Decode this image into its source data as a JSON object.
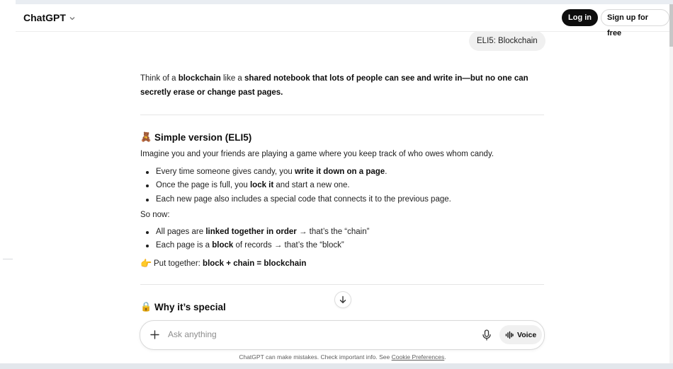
{
  "header": {
    "brand": "ChatGPT",
    "login_label": "Log in",
    "signup_label": "Sign up for free"
  },
  "user_message": "ELI5: Blockchain",
  "intro": {
    "t1": "Think of a ",
    "b1": "blockchain",
    "t2": " like a ",
    "b2": "shared notebook that lots of people can see and write in—but no one can secretly erase or change past pages."
  },
  "section1": {
    "emoji": "🧸",
    "title": "Simple version (ELI5)",
    "lead": "Imagine you and your friends are playing a game where you keep track of who owes whom candy.",
    "bullets": [
      {
        "t1": "Every time someone gives candy, you ",
        "b": "write it down on a page",
        "t2": "."
      },
      {
        "t1": "Once the page is full, you ",
        "b": "lock it",
        "t2": " and start a new one."
      },
      {
        "t1": "Each new page also includes a special code that connects it to the previous page.",
        "b": "",
        "t2": ""
      }
    ],
    "so_now": "So now:",
    "bullets2": [
      {
        "t1": "All pages are ",
        "b": "linked together in order",
        "t2": " → that’s the “chain”"
      },
      {
        "t1": "Each page is a ",
        "b": "block",
        "t2": " of records → that’s the “block”"
      }
    ],
    "together_emoji": "👉",
    "together_t": "Put together: ",
    "together_b": "block + chain = blockchain"
  },
  "section2": {
    "emoji": "🔒",
    "title": "Why it’s special"
  },
  "composer": {
    "placeholder": "Ask anything",
    "voice_label": "Voice"
  },
  "footer": {
    "disclaimer": "ChatGPT can make mistakes. Check important info. See ",
    "link": "Cookie Preferences",
    "end": "."
  }
}
